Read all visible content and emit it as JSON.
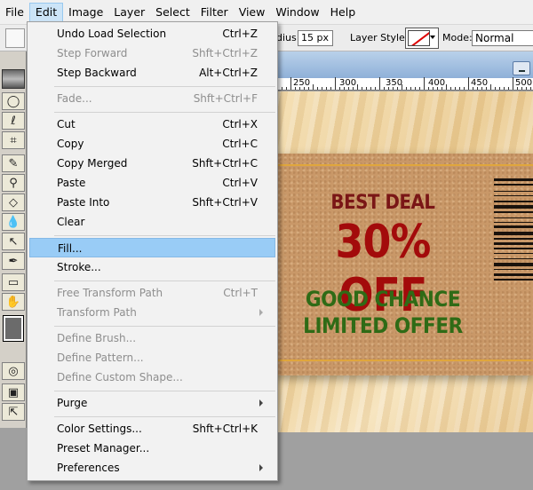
{
  "menubar": {
    "items": [
      "File",
      "Edit",
      "Image",
      "Layer",
      "Select",
      "Filter",
      "View",
      "Window",
      "Help"
    ]
  },
  "options": {
    "radius_label": "dius:",
    "radius_value": "15 px",
    "layer_style_label": "Layer Style:",
    "mode_label": "Mode:",
    "mode_value": "Normal"
  },
  "ruler": {
    "labels": [
      "250",
      "300",
      "350",
      "400",
      "450",
      "500"
    ]
  },
  "coupon": {
    "best_deal": "BEST DEAL",
    "percent_off": "30% OFF",
    "good_chance": "GOOD CHANCE",
    "limited_offer": "LIMITED OFFER"
  },
  "edit_menu": {
    "items": [
      {
        "label": "Undo Load Selection",
        "shortcut": "Ctrl+Z",
        "enabled": true
      },
      {
        "label": "Step Forward",
        "shortcut": "Shft+Ctrl+Z",
        "enabled": false
      },
      {
        "label": "Step Backward",
        "shortcut": "Alt+Ctrl+Z",
        "enabled": true
      },
      {
        "label": "Fade...",
        "shortcut": "Shft+Ctrl+F",
        "enabled": false
      },
      {
        "label": "Cut",
        "shortcut": "Ctrl+X",
        "enabled": true
      },
      {
        "label": "Copy",
        "shortcut": "Ctrl+C",
        "enabled": true
      },
      {
        "label": "Copy Merged",
        "shortcut": "Shft+Ctrl+C",
        "enabled": true
      },
      {
        "label": "Paste",
        "shortcut": "Ctrl+V",
        "enabled": true
      },
      {
        "label": "Paste Into",
        "shortcut": "Shft+Ctrl+V",
        "enabled": true
      },
      {
        "label": "Clear",
        "shortcut": "",
        "enabled": true
      },
      {
        "label": "Fill...",
        "shortcut": "",
        "enabled": true,
        "highlighted": true
      },
      {
        "label": "Stroke...",
        "shortcut": "",
        "enabled": true
      },
      {
        "label": "Free Transform Path",
        "shortcut": "Ctrl+T",
        "enabled": false
      },
      {
        "label": "Transform Path",
        "shortcut": "",
        "enabled": false,
        "submenu": true
      },
      {
        "label": "Define Brush...",
        "shortcut": "",
        "enabled": false
      },
      {
        "label": "Define Pattern...",
        "shortcut": "",
        "enabled": false
      },
      {
        "label": "Define Custom Shape...",
        "shortcut": "",
        "enabled": false
      },
      {
        "label": "Purge",
        "shortcut": "",
        "enabled": true,
        "submenu": true
      },
      {
        "label": "Color Settings...",
        "shortcut": "Shft+Ctrl+K",
        "enabled": true
      },
      {
        "label": "Preset Manager...",
        "shortcut": "",
        "enabled": true
      },
      {
        "label": "Preferences",
        "shortcut": "",
        "enabled": true,
        "submenu": true
      }
    ]
  },
  "colors": {
    "menu_highlight": "#99ccf6",
    "coupon_red": "#a30b0b",
    "coupon_green": "#2f6b16",
    "foreground_color": "#6b6b6b"
  },
  "icons": {
    "toolbox": [
      "marquee-icon",
      "lasso-icon",
      "crop-icon",
      "brush-icon",
      "stamp-icon",
      "eraser-icon",
      "blur-icon",
      "move-icon",
      "pen-icon",
      "path-select-icon",
      "hand-icon",
      "quick-mask-icon",
      "screen-mode-icon",
      "jump-icon"
    ]
  }
}
